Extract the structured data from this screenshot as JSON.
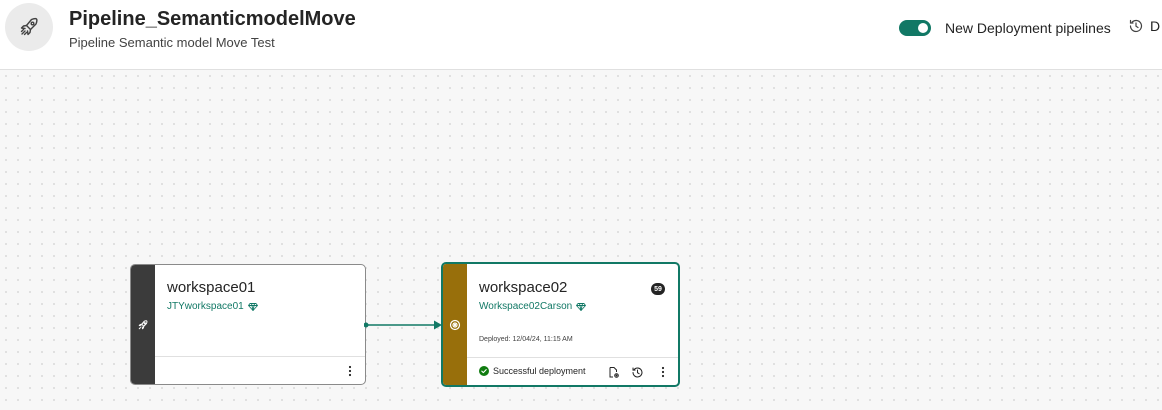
{
  "header": {
    "title": "Pipeline_SemanticmodelMove",
    "subtitle": "Pipeline Semantic model Move Test",
    "toggle_label": "New Deployment pipelines",
    "toggle_on": true,
    "history_label": "D"
  },
  "stages": [
    {
      "name": "workspace01",
      "workspace_link": "JTYworkspace01",
      "strip_icon": "rocket-icon",
      "color": "#3b3b3b"
    },
    {
      "name": "workspace02",
      "workspace_link": "Workspace02Carson",
      "badge_count": "59",
      "deployed_text": "Deployed: 12/04/24, 11:15 AM",
      "status_text": "Successful deployment",
      "strip_icon": "target-icon",
      "color": "#986f0b"
    }
  ],
  "colors": {
    "accent": "#117865",
    "success": "#107c10",
    "dev_stage": "#3b3b3b",
    "prod_stage": "#986f0b"
  }
}
